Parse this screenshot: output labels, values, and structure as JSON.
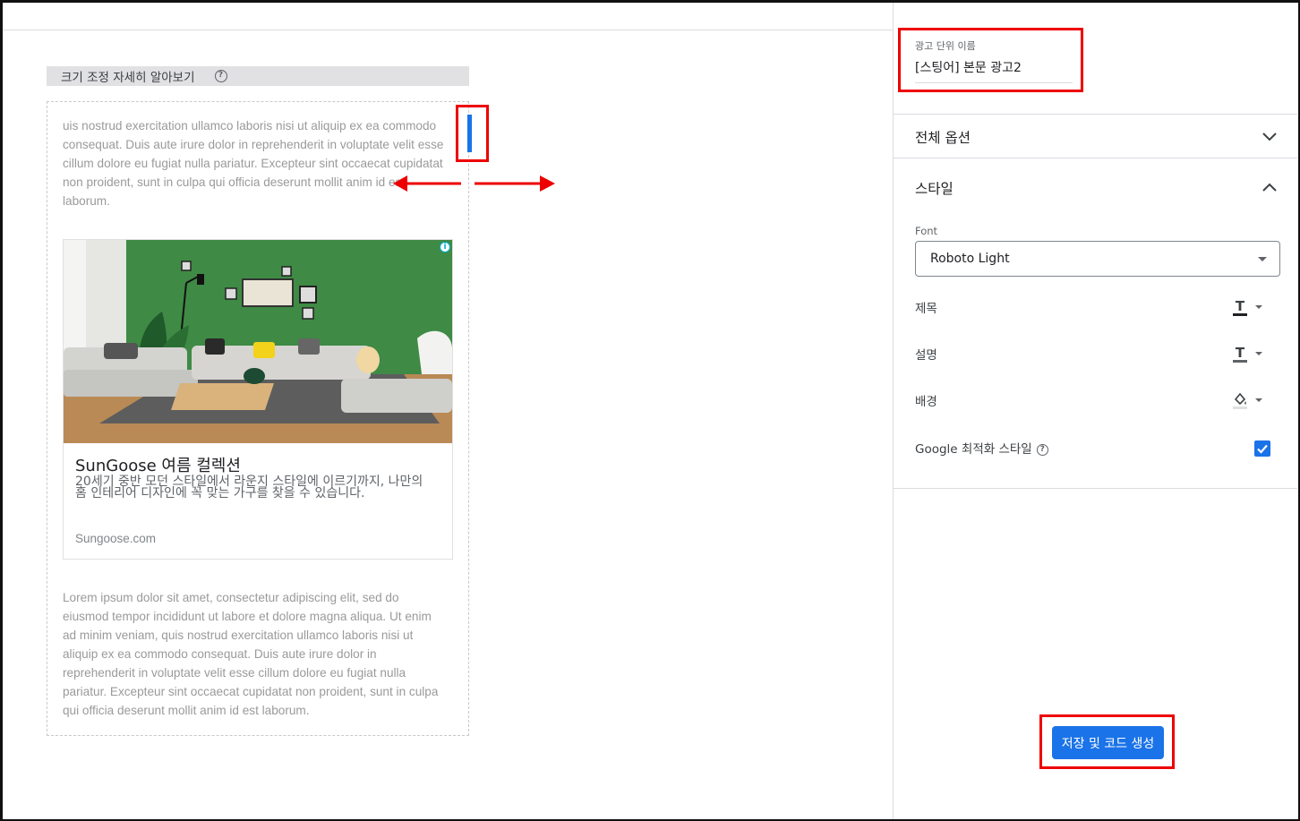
{
  "preview": {
    "resize_help_text": "크기 조정 자세히 알아보기",
    "lorem_top": "uis nostrud exercitation ullamco laboris nisi ut aliquip ex ea commodo consequat. Duis aute irure dolor in reprehenderit in voluptate velit esse cillum dolore eu fugiat nulla pariatur. Excepteur sint occaecat cupidatat non proident, sunt in culpa qui officia deserunt mollit anim id est laborum.",
    "ad": {
      "title": "SunGoose 여름 컬렉션",
      "description": "20세기 중반 모던 스타일에서 라운지 스타일에 이르기까지, 나만의 홈 인테리어 디자인에 꼭 맞는 가구를 찾을 수 있습니다.",
      "url": "Sungoose.com",
      "info_icon": "info-icon"
    },
    "lorem_bottom": "Lorem ipsum dolor sit amet, consectetur adipiscing elit, sed do eiusmod tempor incididunt ut labore et dolore magna aliqua. Ut enim ad minim veniam, quis nostrud exercitation ullamco laboris nisi ut aliquip ex ea commodo consequat. Duis aute irure dolor in reprehenderit in voluptate velit esse cillum dolore eu fugiat nulla pariatur. Excepteur sint occaecat cupidatat non proident, sunt in culpa qui officia deserunt mollit anim id est laborum."
  },
  "panel": {
    "unit_name_label": "광고 단위 이름",
    "unit_name_value": "[스팅어] 본문 광고2",
    "all_options": "전체 옵션",
    "style_section": "스타일",
    "font_label": "Font",
    "font_value": "Roboto Light",
    "title_label": "제목",
    "description_label": "설명",
    "background_label": "배경",
    "google_optimized_label": "Google 최적화 스타일",
    "google_optimized_checked": true,
    "save_button": "저장 및 코드 생성"
  },
  "colors": {
    "accent": "#1a73e8",
    "annotation": "#ee0000"
  }
}
